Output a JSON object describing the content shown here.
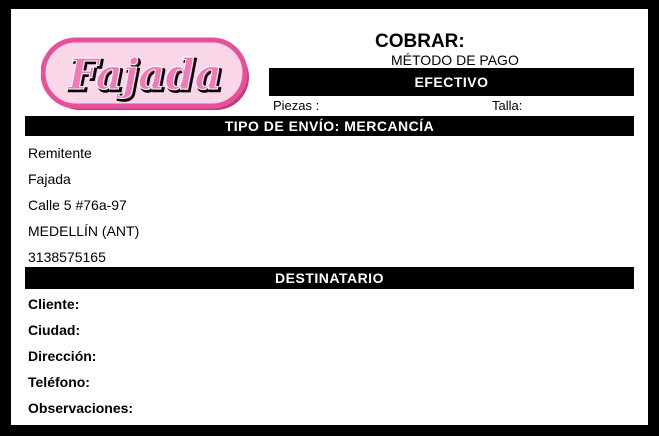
{
  "logo": {
    "text": "Fajada",
    "color": "#e8519a",
    "bg": "#f9d6e8"
  },
  "cobrar": "COBRAR:",
  "metodo_pago": {
    "label": "MÉTODO DE PAGO",
    "value": "EFECTIVO"
  },
  "piezas_label": "Piezas :",
  "talla_label": "Talla:",
  "tipo_envio": "TIPO DE ENVÍO: MERCANCÍA",
  "remitente": {
    "heading": "Remitente",
    "name": "Fajada",
    "address": "Calle 5 #76a-97",
    "city": "MEDELLÍN (ANT)",
    "phone": "3138575165"
  },
  "destinatario": {
    "heading": "DESTINATARIO",
    "cliente": "Cliente:",
    "ciudad": "Ciudad:",
    "direccion": "Dirección:",
    "telefono": "Teléfono:",
    "observaciones": "Observaciones:"
  }
}
